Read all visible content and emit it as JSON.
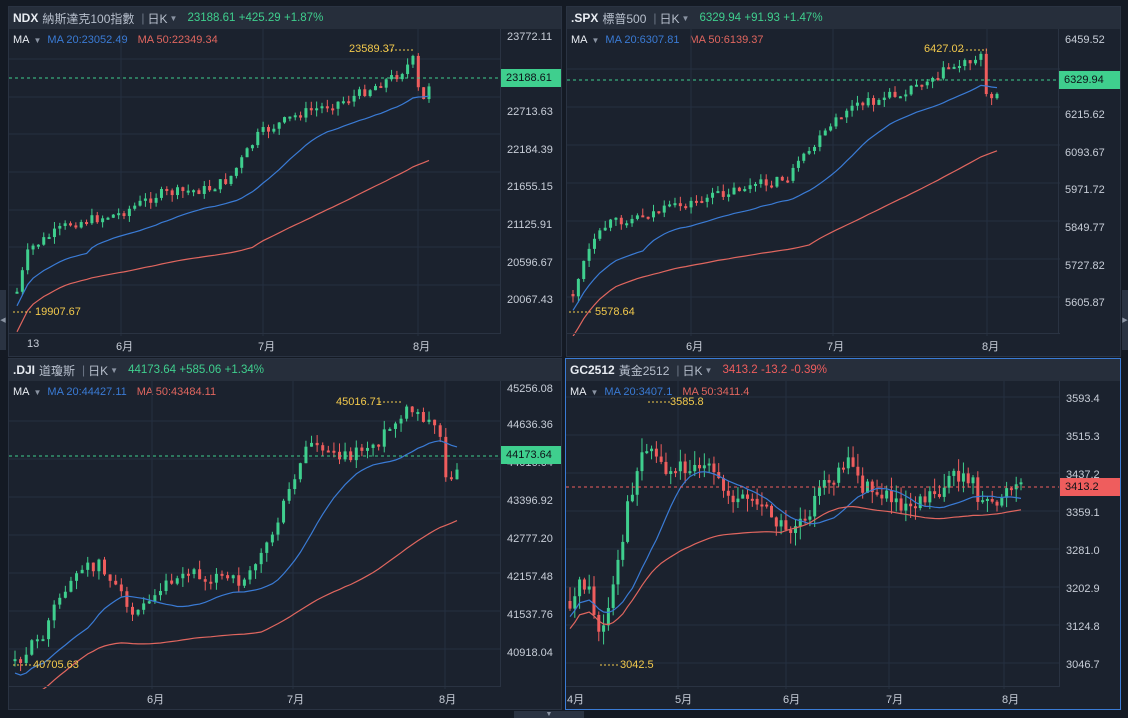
{
  "panels": [
    {
      "id": "ndx",
      "symbol": "NDX",
      "name": "納斯達克100指數",
      "period": "日K",
      "last": "23188.61",
      "change": "+425.29",
      "pct": "+1.87%",
      "direction": "up",
      "ma20": "20:23052.49",
      "ma50": "50:22349.34",
      "price_ticks": [
        "23772.11",
        "22713.63",
        "22184.39",
        "21655.15",
        "21125.91",
        "20596.67",
        "20067.43"
      ],
      "time_ticks": [
        "13",
        "6月",
        "7月",
        "8月"
      ],
      "high_label": "23589.37",
      "low_label": "19907.67"
    },
    {
      "id": "spx",
      "symbol": ".SPX",
      "name": "標普500",
      "period": "日K",
      "last": "6329.94",
      "change": "+91.93",
      "pct": "+1.47%",
      "direction": "up",
      "ma20": "20:6307.81",
      "ma50": "50:6139.37",
      "price_ticks": [
        "6459.52",
        "6215.62",
        "6093.67",
        "5971.72",
        "5849.77",
        "5727.82",
        "5605.87"
      ],
      "time_ticks": [
        "6月",
        "7月",
        "8月"
      ],
      "high_label": "6427.02",
      "low_label": "5578.64"
    },
    {
      "id": "dji",
      "symbol": ".DJI",
      "name": "道瓊斯",
      "period": "日K",
      "last": "44173.64",
      "change": "+585.06",
      "pct": "+1.34%",
      "direction": "up",
      "ma20": "20:44427.11",
      "ma50": "50:43484.11",
      "price_ticks": [
        "45256.08",
        "44636.36",
        "44016.64",
        "43396.92",
        "42777.20",
        "42157.48",
        "41537.76",
        "40918.04"
      ],
      "time_ticks": [
        "6月",
        "7月",
        "8月"
      ],
      "high_label": "45016.71",
      "low_label": "40705.63"
    },
    {
      "id": "gc",
      "symbol": "GC2512",
      "name": "黃金2512",
      "period": "日K",
      "last": "3413.2",
      "change": "-13.2",
      "pct": "-0.39%",
      "direction": "down",
      "ma20": "20:3407.1",
      "ma50": "50:3411.4",
      "price_ticks": [
        "3593.4",
        "3515.3",
        "3437.2",
        "3359.1",
        "3281.0",
        "3202.9",
        "3124.8",
        "3046.7"
      ],
      "time_ticks": [
        "4月",
        "5月",
        "6月",
        "7月",
        "8月"
      ],
      "high_label": "3585.8",
      "low_label": "3042.5"
    }
  ],
  "common": {
    "ma_label": "MA",
    "sep": "|"
  },
  "colors": {
    "up": "#3fcf8e",
    "down": "#ef5d5d",
    "ma20": "#3a7bd5",
    "ma50": "#e0665f",
    "accent": "#3a7bd5"
  }
}
